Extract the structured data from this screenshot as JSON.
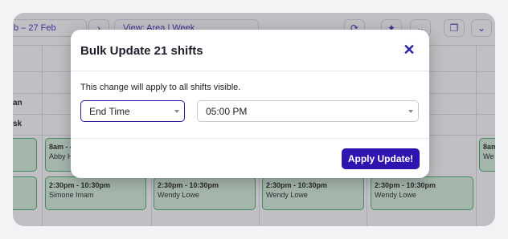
{
  "toolbar": {
    "date_range": "b – 27 Feb",
    "next_icon": "chevron-right-icon",
    "view_label": "View: Area | Week"
  },
  "rows": [
    {
      "label": "an"
    },
    {
      "label": "sk"
    }
  ],
  "shifts_top": [
    {
      "time": "8am - 4",
      "name": "Abby H"
    },
    {
      "time": "8am",
      "name": "We"
    }
  ],
  "shifts_bottom": [
    {
      "time": "2:30pm - 10:30pm",
      "name": "Simone Imam"
    },
    {
      "time": "2:30pm - 10:30pm",
      "name": "Wendy Lowe"
    },
    {
      "time": "2:30pm - 10:30pm",
      "name": "Wendy Lowe"
    },
    {
      "time": "2:30pm - 10:30pm",
      "name": "Wendy Lowe"
    }
  ],
  "modal": {
    "title": "Bulk Update 21 shifts",
    "close_icon": "close-icon",
    "info": "This change will apply to all shifts visible.",
    "field_select": "End Time",
    "value_select": "05:00 PM",
    "apply_label": "Apply Update!"
  },
  "colors": {
    "accent": "#2f14b0",
    "shift_bg": "#d7f2dc",
    "shift_border": "#4caf6a"
  }
}
